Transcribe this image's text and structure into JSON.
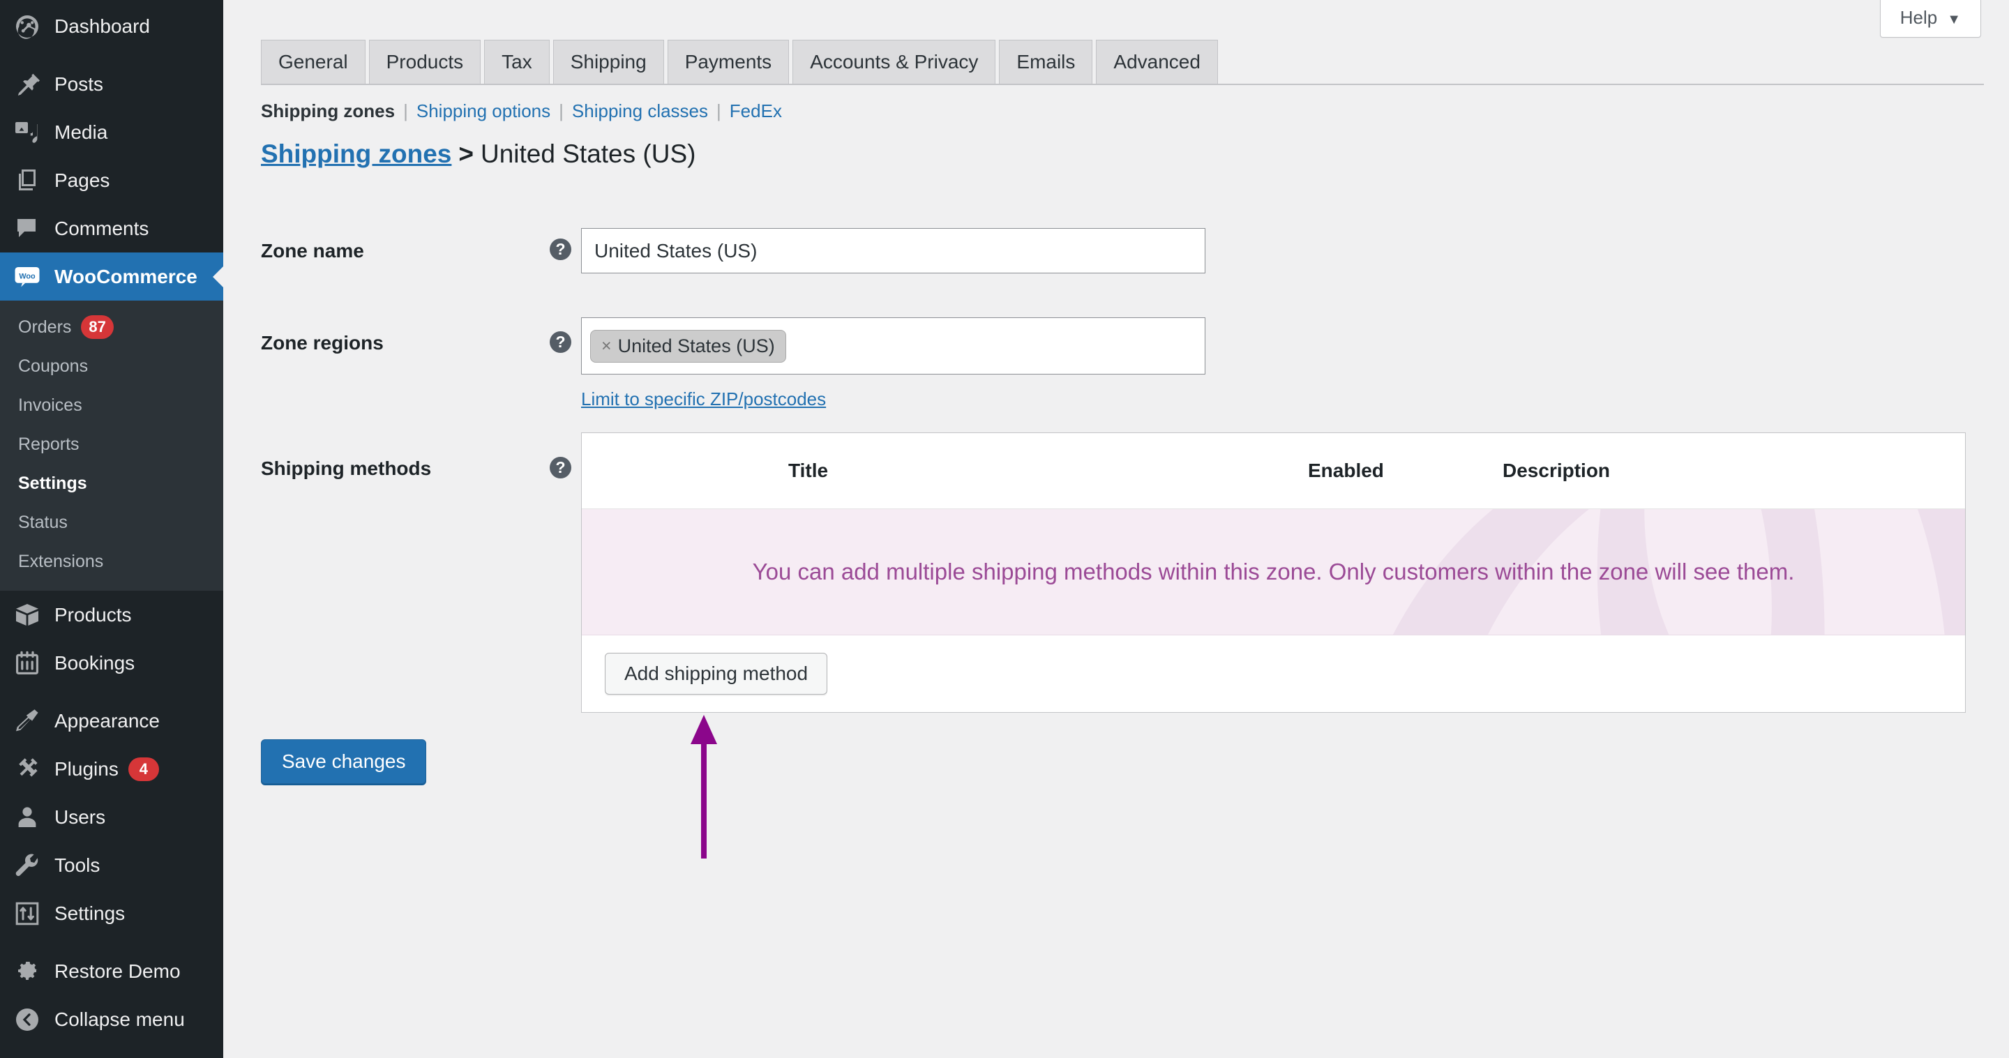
{
  "sidebar": {
    "items": [
      {
        "label": "Dashboard",
        "icon": "dashboard-icon"
      },
      {
        "label": "Posts",
        "icon": "pin-icon"
      },
      {
        "label": "Media",
        "icon": "media-icon"
      },
      {
        "label": "Pages",
        "icon": "pages-icon"
      },
      {
        "label": "Comments",
        "icon": "comment-icon"
      },
      {
        "label": "WooCommerce",
        "icon": "woo-icon",
        "current": true
      },
      {
        "label": "Products",
        "icon": "box-icon"
      },
      {
        "label": "Bookings",
        "icon": "calendar-icon"
      },
      {
        "label": "Appearance",
        "icon": "brush-icon"
      },
      {
        "label": "Plugins",
        "icon": "plug-icon",
        "badge": "4"
      },
      {
        "label": "Users",
        "icon": "user-icon"
      },
      {
        "label": "Tools",
        "icon": "wrench-icon"
      },
      {
        "label": "Settings",
        "icon": "sliders-icon"
      },
      {
        "label": "Restore Demo",
        "icon": "gear-icon"
      },
      {
        "label": "Collapse menu",
        "icon": "collapse-icon"
      }
    ],
    "submenu": [
      {
        "label": "Orders",
        "badge": "87"
      },
      {
        "label": "Coupons"
      },
      {
        "label": "Invoices"
      },
      {
        "label": "Reports"
      },
      {
        "label": "Settings",
        "active": true
      },
      {
        "label": "Status"
      },
      {
        "label": "Extensions"
      }
    ]
  },
  "header": {
    "help_label": "Help",
    "help_caret": "▼"
  },
  "tabs": [
    {
      "label": "General"
    },
    {
      "label": "Products"
    },
    {
      "label": "Tax"
    },
    {
      "label": "Shipping"
    },
    {
      "label": "Payments"
    },
    {
      "label": "Accounts & Privacy"
    },
    {
      "label": "Emails"
    },
    {
      "label": "Advanced"
    }
  ],
  "subnav": {
    "current": "Shipping zones",
    "links": [
      "Shipping options",
      "Shipping classes",
      "FedEx"
    ],
    "separator": "|"
  },
  "breadcrumb": {
    "link": "Shipping zones",
    "separator": ">",
    "current": "United States (US)"
  },
  "form": {
    "zone_name": {
      "label": "Zone name",
      "help": "?",
      "value": "United States (US)"
    },
    "zone_regions": {
      "label": "Zone regions",
      "help": "?",
      "chip_remove": "×",
      "chip_label": "United States (US)",
      "zip_link": "Limit to specific ZIP/postcodes"
    },
    "shipping_methods": {
      "label": "Shipping methods",
      "help": "?",
      "columns": [
        "Title",
        "Enabled",
        "Description"
      ],
      "empty_message": "You can add multiple shipping methods within this zone. Only customers within the zone will see them.",
      "add_button": "Add shipping method"
    },
    "save_button": "Save changes"
  },
  "colors": {
    "accent": "#2271b1",
    "sidebar_bg": "#1d2327",
    "badge": "#d63638",
    "empty_row_bg": "#f6ecf4",
    "empty_row_text": "#9b4a96",
    "annotation_arrow": "#8b068b"
  }
}
